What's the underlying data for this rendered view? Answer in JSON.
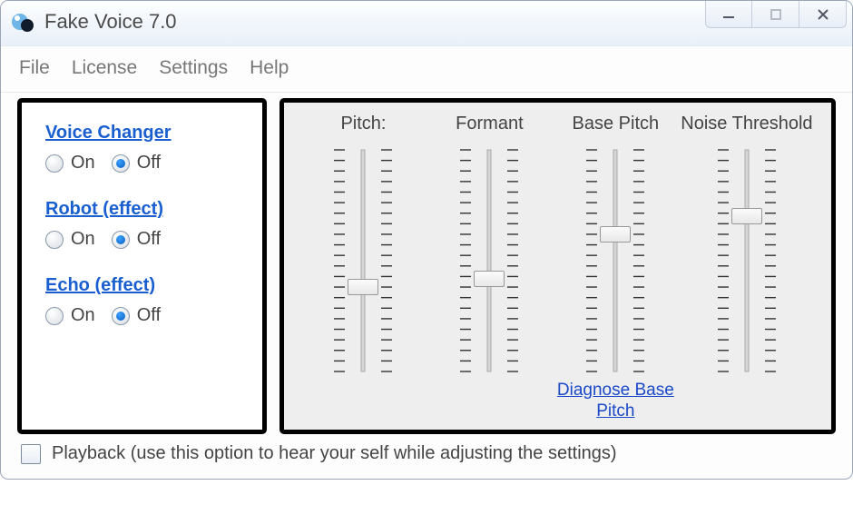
{
  "window": {
    "title": "Fake Voice 7.0"
  },
  "menu": {
    "items": [
      "File",
      "License",
      "Settings",
      "Help"
    ]
  },
  "effects": [
    {
      "title": "Voice Changer",
      "on_label": "On",
      "off_label": "Off",
      "value": "off"
    },
    {
      "title": "Robot (effect)",
      "on_label": "On",
      "off_label": "Off",
      "value": "off"
    },
    {
      "title": "Echo (effect)",
      "on_label": "On",
      "off_label": "Off",
      "value": "off"
    }
  ],
  "sliders": [
    {
      "label": "Pitch:",
      "value": 38
    },
    {
      "label": "Formant",
      "value": 42
    },
    {
      "label": "Base Pitch",
      "value": 62,
      "link": "Diagnose\nBase Pitch"
    },
    {
      "label": "Noise Threshold",
      "value": 70
    }
  ],
  "playback": {
    "checked": false,
    "label": "Playback (use this option to hear your self while adjusting the settings)"
  }
}
